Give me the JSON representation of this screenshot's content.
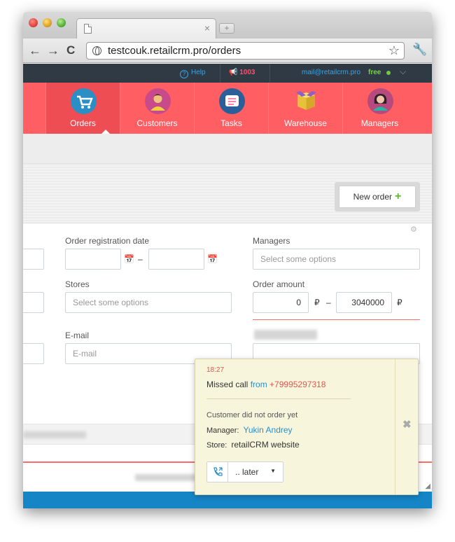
{
  "browser": {
    "url": "testcouk.retailcrm.pro/orders",
    "tab_close": "×",
    "new_tab": "+"
  },
  "topbar": {
    "help": "Help",
    "calls_count": "1003",
    "email": "mail@retailcrm.pro",
    "plan": "free"
  },
  "nav": {
    "items": [
      {
        "label": "Orders"
      },
      {
        "label": "Customers"
      },
      {
        "label": "Tasks"
      },
      {
        "label": "Warehouse"
      },
      {
        "label": "Managers"
      }
    ]
  },
  "actions": {
    "new_order": "New order"
  },
  "filters": {
    "order_date_label": "Order registration date",
    "date_dash": "–",
    "managers_label": "Managers",
    "managers_placeholder": "Select some options",
    "stores_label": "Stores",
    "stores_placeholder": "Select some options",
    "amount_label": "Order amount",
    "amount_from": "0",
    "amount_to": "3040000",
    "currency": "₽",
    "amount_dash": "–",
    "email_label": "E-mail",
    "email_placeholder": "E-mail"
  },
  "popup": {
    "time": "18:27",
    "title": "Missed call",
    "from_word": "from",
    "phone": "+79995297318",
    "status": "Customer did not order yet",
    "manager_label": "Manager:",
    "manager_value": "Yukin Andrey",
    "store_label": "Store:",
    "store_value": "retailCRM website",
    "later_button": ".. later"
  }
}
